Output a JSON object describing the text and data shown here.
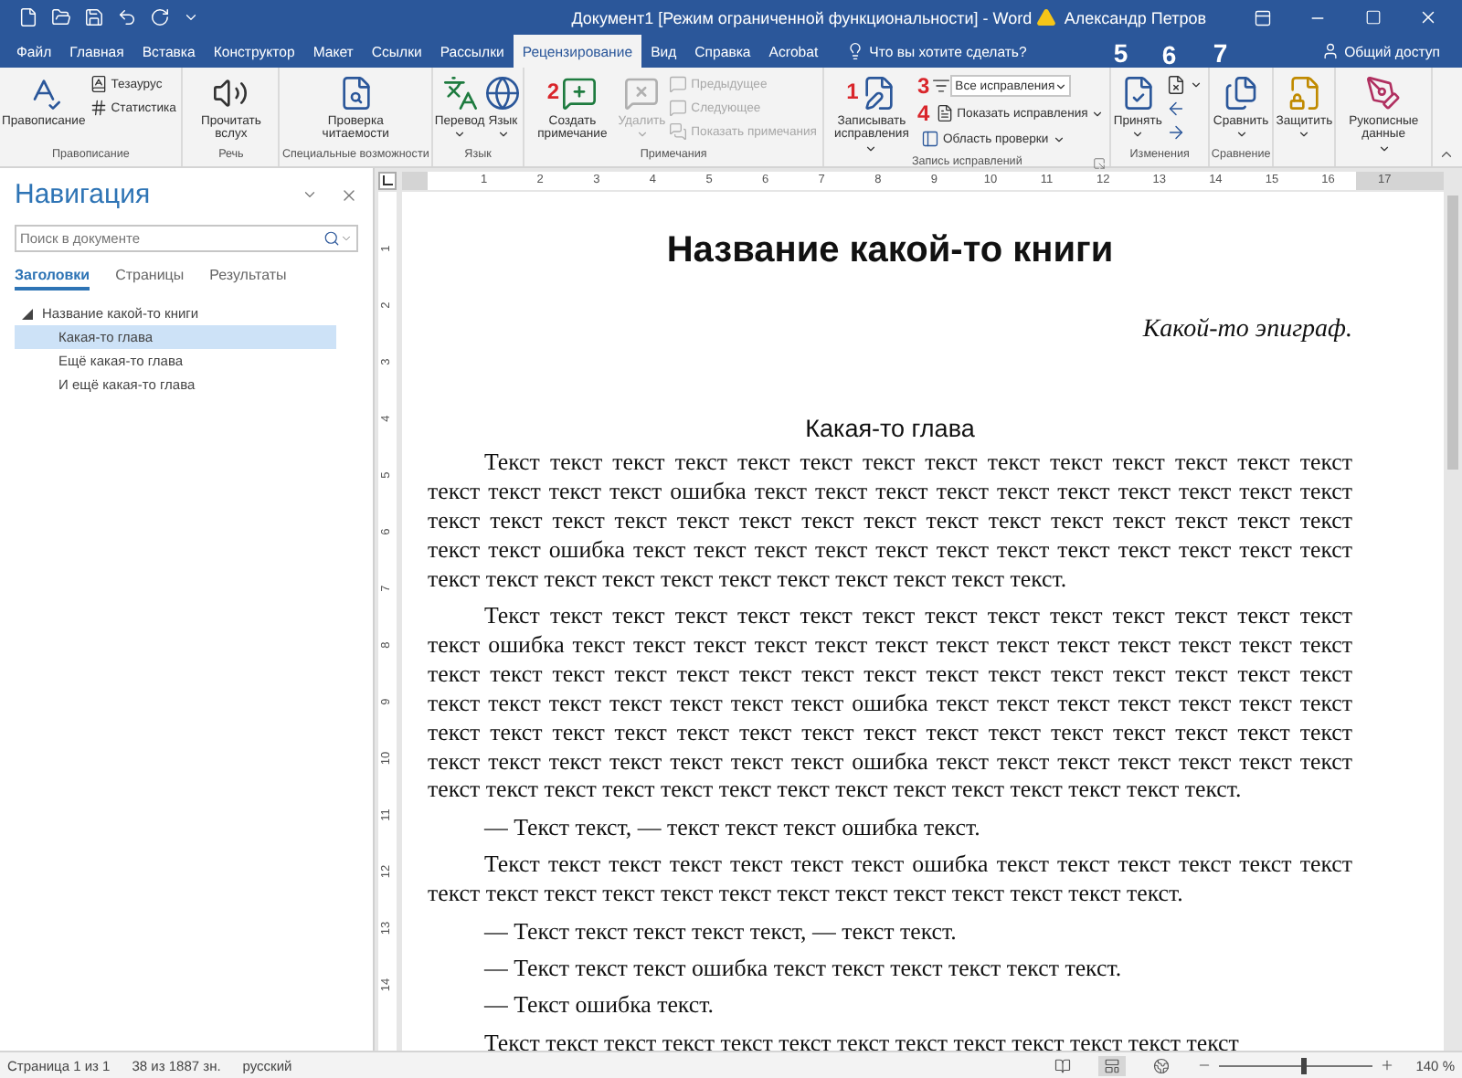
{
  "window": {
    "title": "Документ1 [Режим ограниченной функциональности]  -  Word",
    "user": "Александр Петров"
  },
  "tabs": [
    {
      "label": "Файл",
      "selected": false
    },
    {
      "label": "Главная",
      "selected": false
    },
    {
      "label": "Вставка",
      "selected": false
    },
    {
      "label": "Конструктор",
      "selected": false
    },
    {
      "label": "Макет",
      "selected": false
    },
    {
      "label": "Ссылки",
      "selected": false
    },
    {
      "label": "Рассылки",
      "selected": false
    },
    {
      "label": "Рецензирование",
      "selected": true
    },
    {
      "label": "Вид",
      "selected": false
    },
    {
      "label": "Справка",
      "selected": false
    },
    {
      "label": "Acrobat",
      "selected": false
    }
  ],
  "tell_me": "Что вы хотите сделать?",
  "share": "Общий доступ",
  "ribbon": {
    "groups": [
      {
        "label": "Правописание",
        "items": [
          {
            "kind": "large",
            "label": "Правописание",
            "disabled": false
          },
          {
            "kind": "stack",
            "items": [
              {
                "kind": "small",
                "label": "Тезаурус",
                "disabled": false
              },
              {
                "kind": "small",
                "label": "Статистика",
                "disabled": false
              }
            ]
          }
        ]
      },
      {
        "label": "Речь",
        "items": [
          {
            "kind": "large",
            "label": "Прочитать вслух",
            "disabled": false
          }
        ]
      },
      {
        "label": "Специальные возможности",
        "items": [
          {
            "kind": "large",
            "label": "Проверка читаемости",
            "disabled": false
          }
        ]
      },
      {
        "label": "Язык",
        "items": [
          {
            "kind": "large",
            "label": "Перевод",
            "dropdown": true,
            "disabled": false
          },
          {
            "kind": "large",
            "label": "Язык",
            "dropdown": true,
            "disabled": false
          }
        ]
      },
      {
        "label": "Примечания",
        "items": [
          {
            "kind": "large",
            "label": "Создать примечание",
            "disabled": false,
            "marker": {
              "kind": "ribbon",
              "text": "2"
            }
          },
          {
            "kind": "large",
            "label": "Удалить",
            "dropdown": true,
            "disabled": true
          },
          {
            "kind": "stack",
            "items": [
              {
                "kind": "small",
                "label": "Предыдущее",
                "disabled": true
              },
              {
                "kind": "small",
                "label": "Следующее",
                "disabled": true
              },
              {
                "kind": "small",
                "label": "Показать примечания",
                "disabled": true
              }
            ]
          }
        ]
      },
      {
        "label": "Запись исправлений",
        "launcher": true,
        "items": [
          {
            "kind": "large",
            "label": "Записывать исправления",
            "dropdown": true,
            "disabled": false,
            "marker": {
              "kind": "ribbon",
              "text": "1"
            }
          },
          {
            "kind": "stack",
            "items": [
              {
                "kind": "combo",
                "value": "Все исправления",
                "disabled": false,
                "marker": {
                  "kind": "ribbon",
                  "text": "3"
                }
              },
              {
                "kind": "small",
                "label": "Показать исправления",
                "dropdown": true,
                "disabled": false,
                "marker": {
                  "kind": "ribbon",
                  "text": "4"
                }
              },
              {
                "kind": "small",
                "label": "Область проверки",
                "dropdown": true,
                "disabled": false
              }
            ]
          }
        ]
      },
      {
        "label": "Изменения",
        "items": [
          {
            "kind": "large",
            "label": "Принять",
            "dropdown": true,
            "disabled": false,
            "marker": {
              "kind": "tab",
              "text": "5"
            }
          },
          {
            "kind": "stack",
            "items": [
              {
                "kind": "icon",
                "dropdown": true,
                "disabled": false,
                "marker": {
                  "kind": "tab",
                  "text": "6"
                }
              },
              {
                "kind": "icon",
                "disabled": false
              },
              {
                "kind": "icon",
                "disabled": false
              }
            ]
          }
        ]
      },
      {
        "label": "Сравнение",
        "items": [
          {
            "kind": "large",
            "label": "Сравнить",
            "dropdown": true,
            "disabled": false,
            "marker": {
              "kind": "tab",
              "text": "7"
            }
          }
        ]
      },
      {
        "items": [
          {
            "kind": "large",
            "label": "Защитить",
            "dropdown": true,
            "disabled": false
          }
        ]
      },
      {
        "items": [
          {
            "kind": "large",
            "label": "Рукописные данные",
            "dropdown": true,
            "disabled": false
          }
        ]
      }
    ]
  },
  "navigation": {
    "title": "Навигация",
    "search": {
      "placeholder": "Поиск в документе"
    },
    "tabs": [
      {
        "label": "Заголовки",
        "selected": true
      },
      {
        "label": "Страницы",
        "selected": false
      },
      {
        "label": "Результаты",
        "selected": false
      }
    ],
    "tree": [
      {
        "label": "Название какой-то книги",
        "expanded": true,
        "selected": false,
        "children": [
          {
            "label": "Какая-то глава",
            "selected": true
          },
          {
            "label": "Ещё какая-то глава",
            "selected": false
          },
          {
            "label": "И ещё какая-то глава",
            "selected": false
          }
        ]
      }
    ]
  },
  "ruler": {
    "horizontal": [
      "1",
      "2",
      "3",
      "4",
      "5",
      "6",
      "7",
      "8",
      "9",
      "10",
      "11",
      "12",
      "13",
      "14",
      "15",
      "16",
      "17"
    ],
    "vertical": [
      "1",
      "2",
      "3",
      "4",
      "5",
      "6",
      "7",
      "8",
      "9",
      "10",
      "11",
      "12",
      "13",
      "14"
    ]
  },
  "document": {
    "title": "Название какой-то книги",
    "epigraph": "Какой-то эпиграф.",
    "chapter": "Какая-то глава",
    "paragraphs": [
      "Текст текст текст текст текст текст текст текст текст текст текст текст текст текст текст текст текст текст ошибка текст текст текст текст текст текст текст текст текст текст текст текст текст текст текст текст текст текст текст текст текст текст текст текст текст текст текст ошибка текст текст текст текст текст текст текст текст текст текст текст текст текст текст текст текст текст текст текст текст текст текст текст.",
      "Текст текст текст текст текст текст текст текст текст текст текст текст текст текст текст ошибка текст текст текст текст текст текст текст текст текст текст текст текст текст текст текст текст текст текст текст текст текст текст текст текст текст текст текст текст текст текст текст текст текст текст текст ошибка текст текст текст текст текст текст текст текст текст текст текст текст текст текст текст текст текст текст текст текст текст текст текст текст текст текст текст текст текст ошибка текст текст текст текст текст текст текст текст текст текст текст текст текст текст текст текст текст текст текст текст текст.",
      "— Текст текст, — текст текст текст ошибка текст.",
      "Текст текст текст текст текст текст текст ошибка текст текст текст текст текст текст текст текст текст текст текст текст текст текст текст текст текст текст текст.",
      "— Текст текст текст текст текст, — текст текст.",
      "— Текст текст текст ошибка текст текст текст текст текст текст.",
      "— Текст ошибка текст.",
      "Текст текст текст текст текст текст текст текст текст текст текст текст текст"
    ]
  },
  "status_bar": {
    "page": "Страница 1 из 1",
    "chars": "38 из 1887 зн.",
    "language": "русский",
    "zoom": {
      "level": 0.55,
      "reading": "140 %"
    }
  }
}
